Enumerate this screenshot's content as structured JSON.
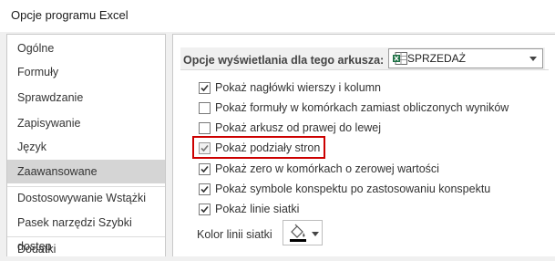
{
  "window": {
    "title": "Opcje programu Excel"
  },
  "sidebar": {
    "items": [
      {
        "label": "Ogólne"
      },
      {
        "label": "Formuły"
      },
      {
        "label": "Sprawdzanie"
      },
      {
        "label": "Zapisywanie"
      },
      {
        "label": "Język"
      },
      {
        "label": "Zaawansowane",
        "selected": true
      },
      {
        "label": "Dostosowywanie Wstążki"
      },
      {
        "label": "Pasek narzędzi Szybki dostęp"
      },
      {
        "label": "Dodatki"
      }
    ]
  },
  "main": {
    "section_title": "Opcje wyświetlania dla tego arkusza:",
    "sheet_select": {
      "value": "SPRZEDAŻ"
    },
    "options": [
      {
        "label": "Pokaż nagłówki wierszy i kolumn",
        "checked": true
      },
      {
        "label": "Pokaż formuły w komórkach zamiast obliczonych wyników",
        "checked": false
      },
      {
        "label": "Pokaż arkusz od prawej do lewej",
        "checked": false
      },
      {
        "label": "Pokaż podziały stron",
        "checked": true,
        "highlighted": true
      },
      {
        "label": "Pokaż zero w komórkach o zerowej wartości",
        "checked": true
      },
      {
        "label": "Pokaż symbole konspektu po zastosowaniu konspektu",
        "checked": true
      },
      {
        "label": "Pokaż linie siatki",
        "checked": true
      }
    ],
    "gridline_color_label": "Kolor linii siatki",
    "gridline_color_icon": "paint-bucket-icon"
  },
  "colors": {
    "highlight_border": "#cc0000",
    "selected_item_bg": "#d5d5d5",
    "excel_green": "#1e7145"
  }
}
